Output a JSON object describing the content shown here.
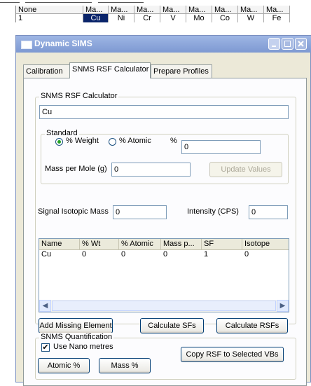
{
  "grid": {
    "header": [
      "None",
      "Ma...",
      "Ma...",
      "Ma...",
      "Ma...",
      "Ma...",
      "Ma...",
      "Ma...",
      "Ma..."
    ],
    "row": [
      "1",
      "Cu",
      "Ni",
      "Cr",
      "V",
      "Mo",
      "Co",
      "W",
      "Fe"
    ]
  },
  "window": {
    "title": "Dynamic SIMS",
    "icon": "window-icon",
    "controls": [
      "minimize-icon",
      "maximize-icon",
      "close-icon"
    ]
  },
  "tabs": [
    {
      "label": "Calibration",
      "active": false
    },
    {
      "label": "SNMS RSF Calculator",
      "active": true
    },
    {
      "label": "Prepare Profiles",
      "active": false
    }
  ],
  "calc": {
    "group_label": "SNMS RSF Calculator",
    "element_value": "Cu",
    "standard": {
      "group_label": "Standard",
      "radio_weight": "% Weight",
      "radio_atomic": "% Atomic",
      "selected": "weight",
      "percent_label": "%",
      "percent_value": "0",
      "mass_label": "Mass per Mole (g)",
      "mass_value": "0",
      "update_button": "Update Values"
    },
    "signal_label": "Signal Isotopic Mass",
    "signal_value": "0",
    "intensity_label": "Intensity (CPS)",
    "intensity_value": "0",
    "list": {
      "columns": [
        "Name",
        "% Wt",
        "% Atomic",
        "Mass p...",
        "SF",
        "Isotope"
      ],
      "rows": [
        [
          "Cu",
          "0",
          "0",
          "0",
          "1",
          "0"
        ]
      ]
    },
    "buttons": {
      "add_missing": "Add Missing Element",
      "calc_sfs": "Calculate SFs",
      "calc_rsfs": "Calculate RSFs"
    }
  },
  "quant": {
    "group_label": "SNMS Quantification",
    "checkbox_label": "Use Nano metres",
    "checkbox_checked": true,
    "copy_button": "Copy RSF to Selected VBs",
    "atomic_button": "Atomic %",
    "mass_button": "Mass %"
  }
}
